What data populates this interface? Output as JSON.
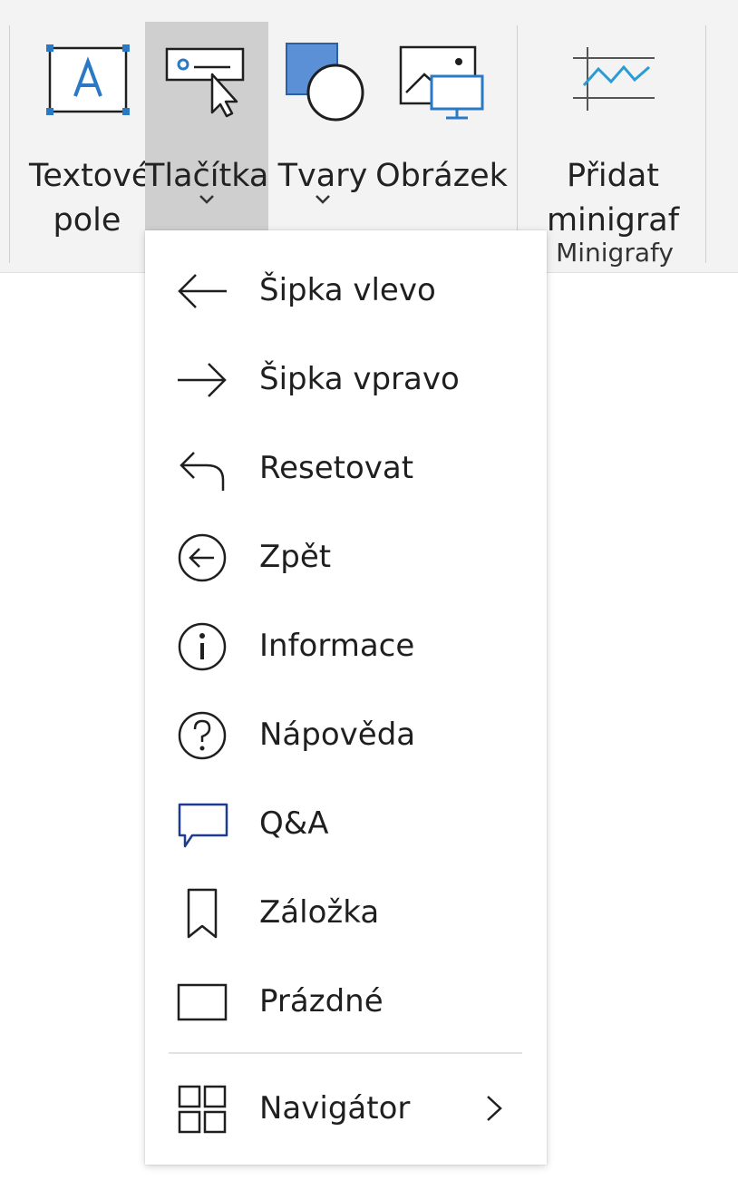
{
  "ribbon": {
    "buttons": [
      {
        "id": "textbox",
        "label": "Textové\npole",
        "icon": "textbox-icon"
      },
      {
        "id": "buttons",
        "label": "Tlačítka",
        "icon": "button-cursor-icon",
        "has_dropdown": true,
        "active": true
      },
      {
        "id": "shapes",
        "label": "Tvary",
        "icon": "shapes-icon",
        "has_dropdown": true
      },
      {
        "id": "image",
        "label": "Obrázek",
        "icon": "image-icon"
      },
      {
        "id": "sparkline",
        "label": "Přidat\nminigraf",
        "icon": "sparkline-icon"
      }
    ],
    "group_label": "Minigrafy"
  },
  "menu": {
    "items": [
      {
        "label": "Šipka vlevo",
        "icon": "arrow-left-icon"
      },
      {
        "label": "Šipka vpravo",
        "icon": "arrow-right-icon"
      },
      {
        "label": "Resetovat",
        "icon": "reset-icon"
      },
      {
        "label": "Zpět",
        "icon": "back-circle-icon"
      },
      {
        "label": "Informace",
        "icon": "info-icon"
      },
      {
        "label": "Nápověda",
        "icon": "help-icon"
      },
      {
        "label": "Q&A",
        "icon": "qna-bubble-icon"
      },
      {
        "label": "Záložka",
        "icon": "bookmark-icon"
      },
      {
        "label": "Prázdné",
        "icon": "blank-rectangle-icon"
      }
    ],
    "navigator": {
      "label": "Navigátor",
      "icon": "navigator-grid-icon",
      "submenu_icon": "chevron-right-icon"
    }
  },
  "colors": {
    "accent": "#2b78c5",
    "qna": "#1f3b8f",
    "ribbon_bg": "#f3f3f3",
    "active_bg": "#cfcfcf"
  }
}
